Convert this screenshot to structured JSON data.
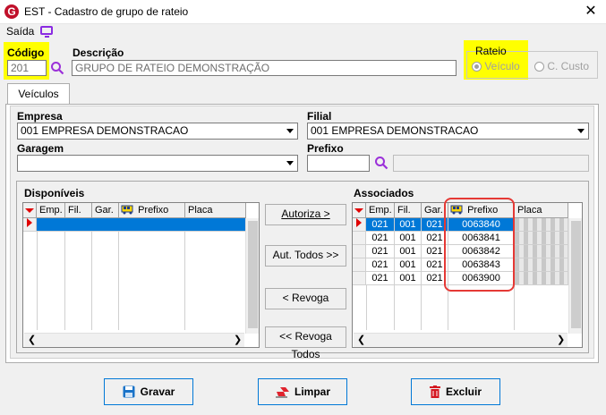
{
  "window": {
    "title": "EST - Cadastro de grupo de rateio",
    "close_glyph": "✕"
  },
  "menu": {
    "saida_label": "Saída"
  },
  "form": {
    "codigo_label": "Código",
    "codigo_value": "201",
    "descricao_label": "Descrição",
    "descricao_value": "GRUPO DE RATEIO DEMONSTRAÇÃO",
    "rateio_label": "Rateio",
    "rateio_options": [
      "Veículo",
      "C. Custo"
    ],
    "rateio_selected": "Veículo"
  },
  "tab": {
    "label": "Veículos"
  },
  "filters": {
    "empresa_label": "Empresa",
    "empresa_value": "001 EMPRESA DEMONSTRACAO",
    "filial_label": "Filial",
    "filial_value": "001 EMPRESA DEMONSTRACAO",
    "garagem_label": "Garagem",
    "garagem_value": "",
    "prefixo_label": "Prefixo",
    "prefixo_value": ""
  },
  "disponiveis": {
    "title": "Disponíveis",
    "columns": [
      "Emp.",
      "Fil.",
      "Gar.",
      "Prefixo",
      "Placa"
    ]
  },
  "associados": {
    "title": "Associados",
    "columns": [
      "Emp.",
      "Fil.",
      "Gar.",
      "Prefixo",
      "Placa"
    ],
    "rows": [
      {
        "emp": "021",
        "fil": "001",
        "gar": "021",
        "prefixo": "0063840"
      },
      {
        "emp": "021",
        "fil": "001",
        "gar": "021",
        "prefixo": "0063841"
      },
      {
        "emp": "021",
        "fil": "001",
        "gar": "021",
        "prefixo": "0063842"
      },
      {
        "emp": "021",
        "fil": "001",
        "gar": "021",
        "prefixo": "0063843"
      },
      {
        "emp": "021",
        "fil": "001",
        "gar": "021",
        "prefixo": "0063900"
      }
    ]
  },
  "transfer_buttons": {
    "autoriza": "Autoriza >",
    "aut_todos": "Aut. Todos >>",
    "revoga": "< Revoga",
    "revoga_todos": "<< Revoga Todos"
  },
  "actions": {
    "gravar": "Gravar",
    "limpar": "Limpar",
    "excluir": "Excluir"
  },
  "colors": {
    "highlight": "#ffff00",
    "selection": "#0078d7",
    "annotation": "#e53935"
  }
}
